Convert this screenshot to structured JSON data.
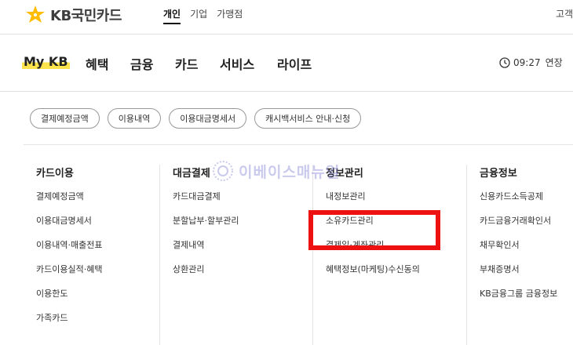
{
  "brand": {
    "logo_text": "KB국민카드"
  },
  "top_nav": {
    "items": [
      "개인",
      "기업",
      "가맹점"
    ],
    "active_index": 0,
    "right_text": "고객"
  },
  "main_nav": {
    "items": [
      "My KB",
      "혜택",
      "금융",
      "카드",
      "서비스",
      "라이프"
    ],
    "clock_time": "09:27",
    "clock_extend": "연장"
  },
  "sub_buttons": [
    "결제예정금액",
    "이용내역",
    "이용대금명세서",
    "캐시백서비스 안내·신청"
  ],
  "columns": [
    {
      "title": "카드이용",
      "links": [
        "결제예정금액",
        "이용대금명세서",
        "이용내역·매출전표",
        "카드이용실적·혜택",
        "이용한도",
        "가족카드"
      ]
    },
    {
      "title": "대금결제",
      "links": [
        "카드대금결제",
        "분할납부·할부관리",
        "결제내역",
        "상환관리"
      ]
    },
    {
      "title": "정보관리",
      "links": [
        "내정보관리",
        "소유카드관리",
        "결제일·계좌관리",
        "혜택정보(마케팅)수신동의"
      ]
    },
    {
      "title": "금융정보",
      "links": [
        "신용카드소득공제",
        "카드금융거래확인서",
        "채무확인서",
        "부채증명서",
        "KB금융그룹 금융정보"
      ]
    }
  ],
  "watermark": {
    "text": "이베이스매뉴얼"
  },
  "colors": {
    "brand_yellow": "#ffbc00",
    "highlight_red": "#ee1111",
    "mykb_underline": "#ffe34d"
  }
}
